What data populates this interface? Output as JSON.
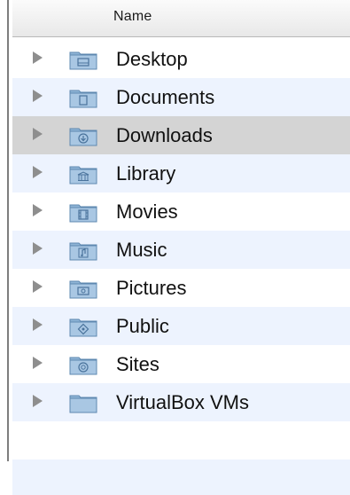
{
  "header": {
    "name_label": "Name"
  },
  "rows": [
    {
      "label": "Desktop",
      "icon": "desktop-folder-icon"
    },
    {
      "label": "Documents",
      "icon": "documents-folder-icon"
    },
    {
      "label": "Downloads",
      "icon": "downloads-folder-icon",
      "selected": true
    },
    {
      "label": "Library",
      "icon": "library-folder-icon"
    },
    {
      "label": "Movies",
      "icon": "movies-folder-icon"
    },
    {
      "label": "Music",
      "icon": "music-folder-icon"
    },
    {
      "label": "Pictures",
      "icon": "pictures-folder-icon"
    },
    {
      "label": "Public",
      "icon": "public-folder-icon"
    },
    {
      "label": "Sites",
      "icon": "sites-folder-icon"
    },
    {
      "label": "VirtualBox VMs",
      "icon": "folder-icon"
    }
  ],
  "colors": {
    "alt_row": "#edf3fe",
    "selected_row": "#d4d4d4",
    "folder_blue": "#8fb4d6"
  }
}
